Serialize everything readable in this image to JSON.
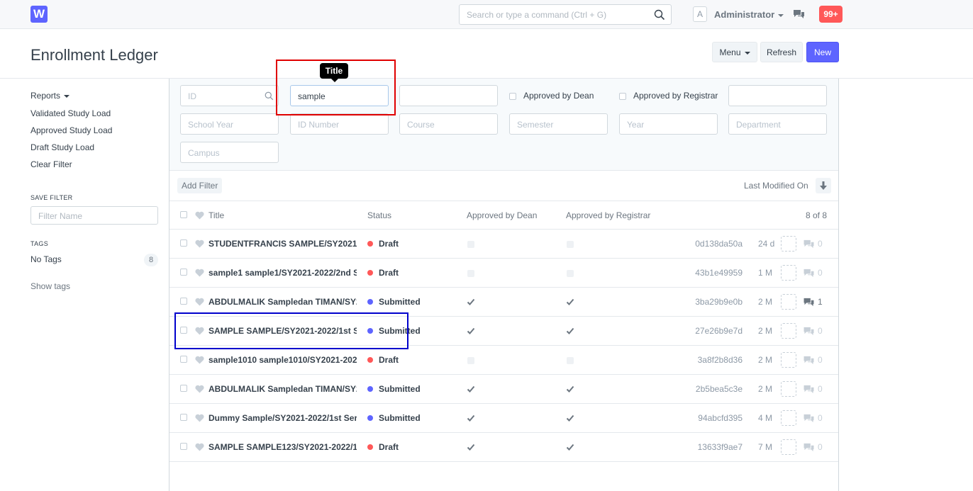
{
  "navbar": {
    "logo": "W",
    "search_placeholder": "Search or type a command (Ctrl + G)",
    "avatar_letter": "A",
    "user_name": "Administrator",
    "notifications": "99+"
  },
  "page": {
    "title": "Enrollment Ledger",
    "menu_label": "Menu",
    "refresh_label": "Refresh",
    "new_label": "New"
  },
  "sidebar": {
    "reports_label": "Reports",
    "links": [
      "Validated Study Load",
      "Approved Study Load",
      "Draft Study Load",
      "Clear Filter"
    ],
    "save_filter_label": "SAVE FILTER",
    "filter_name_placeholder": "Filter Name",
    "tags_label": "TAGS",
    "no_tags_label": "No Tags",
    "no_tags_count": "8",
    "show_tags_label": "Show tags"
  },
  "filters": {
    "id_placeholder": "ID",
    "title_value": "sample",
    "approved_dean": "Approved by Dean",
    "approved_registrar": "Approved by Registrar",
    "school_year": "School Year",
    "id_number": "ID Number",
    "course": "Course",
    "semester": "Semester",
    "year": "Year",
    "department": "Department",
    "campus": "Campus",
    "tooltip": "Title"
  },
  "toolbar": {
    "add_filter": "Add Filter",
    "sort_label": "Last Modified On"
  },
  "table": {
    "headers": {
      "title": "Title",
      "status": "Status",
      "approved_dean": "Approved by Dean",
      "approved_registrar": "Approved by Registrar",
      "count": "8 of 8"
    },
    "rows": [
      {
        "title": "STUDENTFRANCIS SAMPLE/SY2021-2",
        "status": "Draft",
        "approved": false,
        "hash": "0d138da50a",
        "age": "24 d",
        "comments": "0"
      },
      {
        "title": "sample1 sample1/SY2021-2022/2nd S",
        "status": "Draft",
        "approved": false,
        "hash": "43b1e49959",
        "age": "1 M",
        "comments": "0"
      },
      {
        "title": "ABDULMALIK Sampledan TIMAN/SY2",
        "status": "Submitted",
        "approved": true,
        "hash": "3ba29b9e0b",
        "age": "2 M",
        "comments": "1"
      },
      {
        "title": "SAMPLE SAMPLE/SY2021-2022/1st Se",
        "status": "Submitted",
        "approved": true,
        "hash": "27e26b9e7d",
        "age": "2 M",
        "comments": "0"
      },
      {
        "title": "sample1010 sample1010/SY2021-202",
        "status": "Draft",
        "approved": false,
        "hash": "3a8f2b8d36",
        "age": "2 M",
        "comments": "0"
      },
      {
        "title": "ABDULMALIK Sampledan TIMAN/SY2",
        "status": "Submitted",
        "approved": true,
        "hash": "2b5bea5c3e",
        "age": "2 M",
        "comments": "0"
      },
      {
        "title": "Dummy Sample/SY2021-2022/1st Ser",
        "status": "Submitted",
        "approved": true,
        "hash": "94abcfd395",
        "age": "4 M",
        "comments": "0"
      },
      {
        "title": "SAMPLE SAMPLE123/SY2021-2022/1:",
        "status": "Draft",
        "approved": true,
        "hash": "13633f9ae7",
        "age": "7 M",
        "comments": "0"
      }
    ]
  },
  "colors": {
    "primary": "#5e64ff",
    "draft": "#ff5858",
    "submitted": "#5e64ff",
    "highlight_red": "#e00000",
    "highlight_blue": "#0000cc"
  }
}
